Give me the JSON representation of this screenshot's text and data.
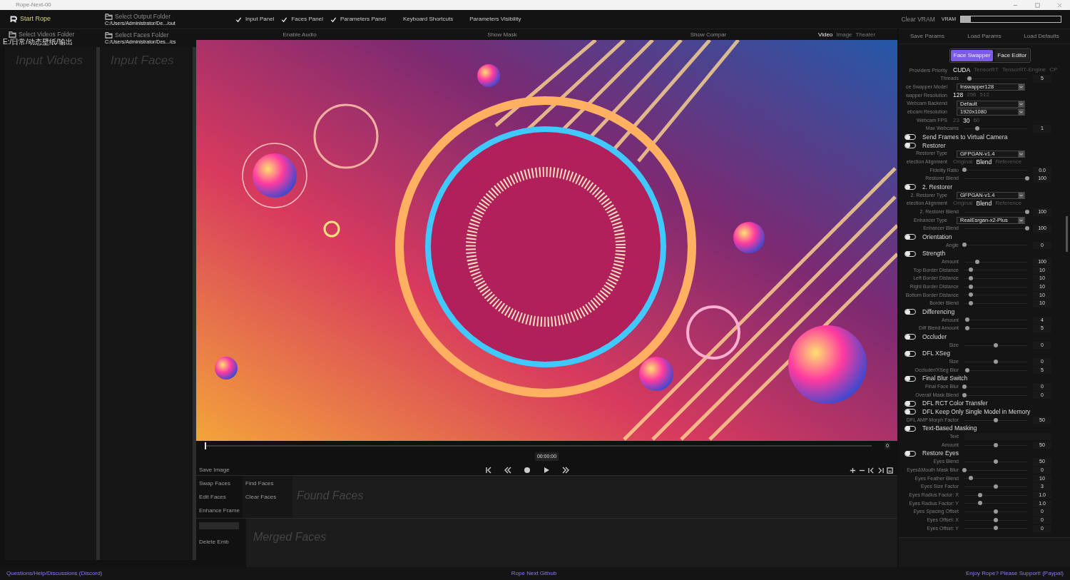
{
  "window": {
    "title": "Rope-Next-00"
  },
  "toolbar": {
    "start": "Start Rope",
    "output_folder": {
      "label": "Select Output Folder",
      "path": "C:/Users/Administrator/De.../out"
    },
    "panels": [
      {
        "label": "Input Panel",
        "checked": true
      },
      {
        "label": "Faces Panel",
        "checked": true
      },
      {
        "label": "Parameters Panel",
        "checked": true
      }
    ],
    "menus": [
      "Keyboard Shortcuts",
      "Parameters Visibility"
    ],
    "clear_vram": "Clear VRAM",
    "vram": {
      "label": "VRAM",
      "level": 0.1
    }
  },
  "folders": [
    {
      "label": "Select Videos Folder",
      "path": "E:/日常/动态壁纸/输出",
      "title": "Input Videos"
    },
    {
      "label": "Select Faces Folder",
      "path": "C:/Users/Administrator/Des.../cs",
      "title": "Input Faces"
    }
  ],
  "viewer": {
    "options": [
      "Enable Audio",
      "Show Mask",
      "Show Compar"
    ],
    "modes": [
      {
        "label": "Video",
        "selected": true
      },
      {
        "label": "Image",
        "selected": false
      },
      {
        "label": "Theater",
        "selected": false
      }
    ]
  },
  "timeline": {
    "level": 0,
    "frame": "0",
    "time": "00:00:00"
  },
  "save_image": "Save Image",
  "face_actions": [
    [
      "Swap Faces",
      "Edit Faces",
      "Enhance Frame"
    ],
    [
      "Find Faces",
      "Clear Faces"
    ]
  ],
  "found_faces": "Found Faces",
  "delete_emb": "Delete Emb",
  "merged_faces": "Merged Faces",
  "param_buttons": [
    "Save Params",
    "Load Params",
    "Load Defaults"
  ],
  "param_tabs": [
    {
      "label": "Face Swapper",
      "selected": true
    },
    {
      "label": "Face Editor",
      "selected": false
    }
  ],
  "params": [
    {
      "kind": "options",
      "label": "Providers Priority",
      "options": [
        {
          "text": "CUDA",
          "selected": true
        },
        {
          "text": "TensorRT",
          "selected": false
        },
        {
          "text": "TensorRT-Engine",
          "selected": false
        },
        {
          "text": "CP",
          "selected": false
        }
      ]
    },
    {
      "kind": "slider",
      "label": "Threads",
      "level": 0.08,
      "value": "5"
    },
    {
      "kind": "select",
      "label": "ce Swapper Model",
      "value": "Inswapper128"
    },
    {
      "kind": "options",
      "label": "wapper Resolution",
      "options": [
        {
          "text": "128",
          "selected": true
        },
        {
          "text": "256",
          "selected": false
        },
        {
          "text": "512",
          "selected": false
        }
      ]
    },
    {
      "kind": "select",
      "label": "Webcam Backend",
      "value": "Default"
    },
    {
      "kind": "select",
      "label": "ebcam Resolution",
      "value": "1920x1080"
    },
    {
      "kind": "options",
      "label": "Webcam FPS",
      "options": [
        {
          "text": "23",
          "selected": false
        },
        {
          "text": "30",
          "selected": true
        },
        {
          "text": "60",
          "selected": false
        }
      ]
    },
    {
      "kind": "slider",
      "label": "Max Webcams",
      "level": 0.2,
      "value": "1"
    },
    {
      "kind": "toggle",
      "label": "Send Frames to Virtual Camera",
      "on": false
    },
    {
      "kind": "toggle",
      "label": "Restorer",
      "on": false
    },
    {
      "kind": "select",
      "label": "Restorer Type",
      "value": "GFPGAN-v1.4"
    },
    {
      "kind": "options",
      "label": "etection Alignment",
      "options": [
        {
          "text": "Original",
          "selected": false
        },
        {
          "text": "Blend",
          "selected": true
        },
        {
          "text": "Reference",
          "selected": false
        }
      ]
    },
    {
      "kind": "slider",
      "label": "Fidelity Ratio",
      "level": 0,
      "value": "0.0"
    },
    {
      "kind": "slider",
      "label": "Restorer Blend",
      "level": 1,
      "value": "100"
    },
    {
      "kind": "toggle",
      "label": "2. Restorer",
      "on": false
    },
    {
      "kind": "select",
      "label": "2. Restorer Type",
      "value": "GFPGAN-v1.4"
    },
    {
      "kind": "options",
      "label": "etection Alignment",
      "options": [
        {
          "text": "Original",
          "selected": false
        },
        {
          "text": "Blend",
          "selected": true
        },
        {
          "text": "Reference",
          "selected": false
        }
      ]
    },
    {
      "kind": "slider",
      "label": "2. Restorer Blend",
      "level": 1,
      "value": "100"
    },
    {
      "kind": "select",
      "label": "Enhancer Type",
      "value": "RealEsrgan-x2-Plus"
    },
    {
      "kind": "slider",
      "label": "Enhancer Blend",
      "level": 1,
      "value": "100"
    },
    {
      "kind": "toggle",
      "label": "Orientation",
      "on": false
    },
    {
      "kind": "slider",
      "label": "Angle",
      "level": 0,
      "value": "0"
    },
    {
      "kind": "toggle",
      "label": "Strength",
      "on": false
    },
    {
      "kind": "slider",
      "label": "Amount",
      "level": 0.2,
      "value": "100"
    },
    {
      "kind": "slider",
      "label": "Top Border Distance",
      "level": 0.1,
      "value": "10"
    },
    {
      "kind": "slider",
      "label": "Left Border Distance",
      "level": 0.1,
      "value": "10"
    },
    {
      "kind": "slider",
      "label": "Right Border Distance",
      "level": 0.1,
      "value": "10"
    },
    {
      "kind": "slider",
      "label": "Bottom Border Distance",
      "level": 0.1,
      "value": "10"
    },
    {
      "kind": "slider",
      "label": "Border Blend",
      "level": 0.1,
      "value": "10"
    },
    {
      "kind": "toggle",
      "label": "Differencing",
      "on": false
    },
    {
      "kind": "slider",
      "label": "Amount",
      "level": 0.05,
      "value": "4"
    },
    {
      "kind": "slider",
      "label": "Diff Blend Amount",
      "level": 0.05,
      "value": "5"
    },
    {
      "kind": "toggle",
      "label": "Occluder",
      "on": false
    },
    {
      "kind": "slider",
      "label": "Size",
      "level": 0.5,
      "value": "0"
    },
    {
      "kind": "toggle",
      "label": "DFL XSeg",
      "on": false
    },
    {
      "kind": "slider",
      "label": "Size",
      "level": 0.5,
      "value": "0"
    },
    {
      "kind": "slider",
      "label": "Occluder/XSeg Blur",
      "level": 0.05,
      "value": "5"
    },
    {
      "kind": "toggle",
      "label": "Final Blur Switch",
      "on": false
    },
    {
      "kind": "slider",
      "label": "Final Face Blur",
      "level": 0,
      "value": "0"
    },
    {
      "kind": "slider",
      "label": "Overall Mask Blend",
      "level": 0,
      "value": "0"
    },
    {
      "kind": "toggle",
      "label": "DFL RCT Color Transfer",
      "on": false
    },
    {
      "kind": "toggle",
      "label": "DFL Keep Only Single Model in Memory",
      "on": false
    },
    {
      "kind": "slider",
      "label": "DFL AMP Morph Factor",
      "level": 0.5,
      "value": "50"
    },
    {
      "kind": "toggle",
      "label": "Text-Based Masking",
      "on": false
    },
    {
      "kind": "text",
      "label": "Text"
    },
    {
      "kind": "slider",
      "label": "Amount",
      "level": 0.5,
      "value": "50"
    },
    {
      "kind": "toggle",
      "label": "Restore Eyes",
      "on": false
    },
    {
      "kind": "slider",
      "label": "Eyes Blend",
      "level": 0.5,
      "value": "50"
    },
    {
      "kind": "slider",
      "label": "Eyes&Mouth Mask Blur",
      "level": 0,
      "value": "0"
    },
    {
      "kind": "slider",
      "label": "Eyes Feather Blend",
      "level": 0.1,
      "value": "10"
    },
    {
      "kind": "slider",
      "label": "Eyes Size Factor",
      "level": 0.5,
      "value": "3"
    },
    {
      "kind": "slider",
      "label": "Eyes Radius Factor: X",
      "level": 0.25,
      "value": "1.0"
    },
    {
      "kind": "slider",
      "label": "Eyes Radius Factor: Y",
      "level": 0.25,
      "value": "1.0"
    },
    {
      "kind": "slider",
      "label": "Eyes Spacing Offset",
      "level": 0.5,
      "value": "0"
    },
    {
      "kind": "slider",
      "label": "Eyes Offset: X",
      "level": 0.5,
      "value": "0"
    },
    {
      "kind": "slider",
      "label": "Eyes Offset: Y",
      "level": 0.5,
      "value": "0"
    }
  ],
  "footer": {
    "left": "Questions/Help/Discussions (Discord)",
    "center": "Rope Next Github",
    "right": "Enjoy Rope? Please Support! (Paypal)"
  }
}
